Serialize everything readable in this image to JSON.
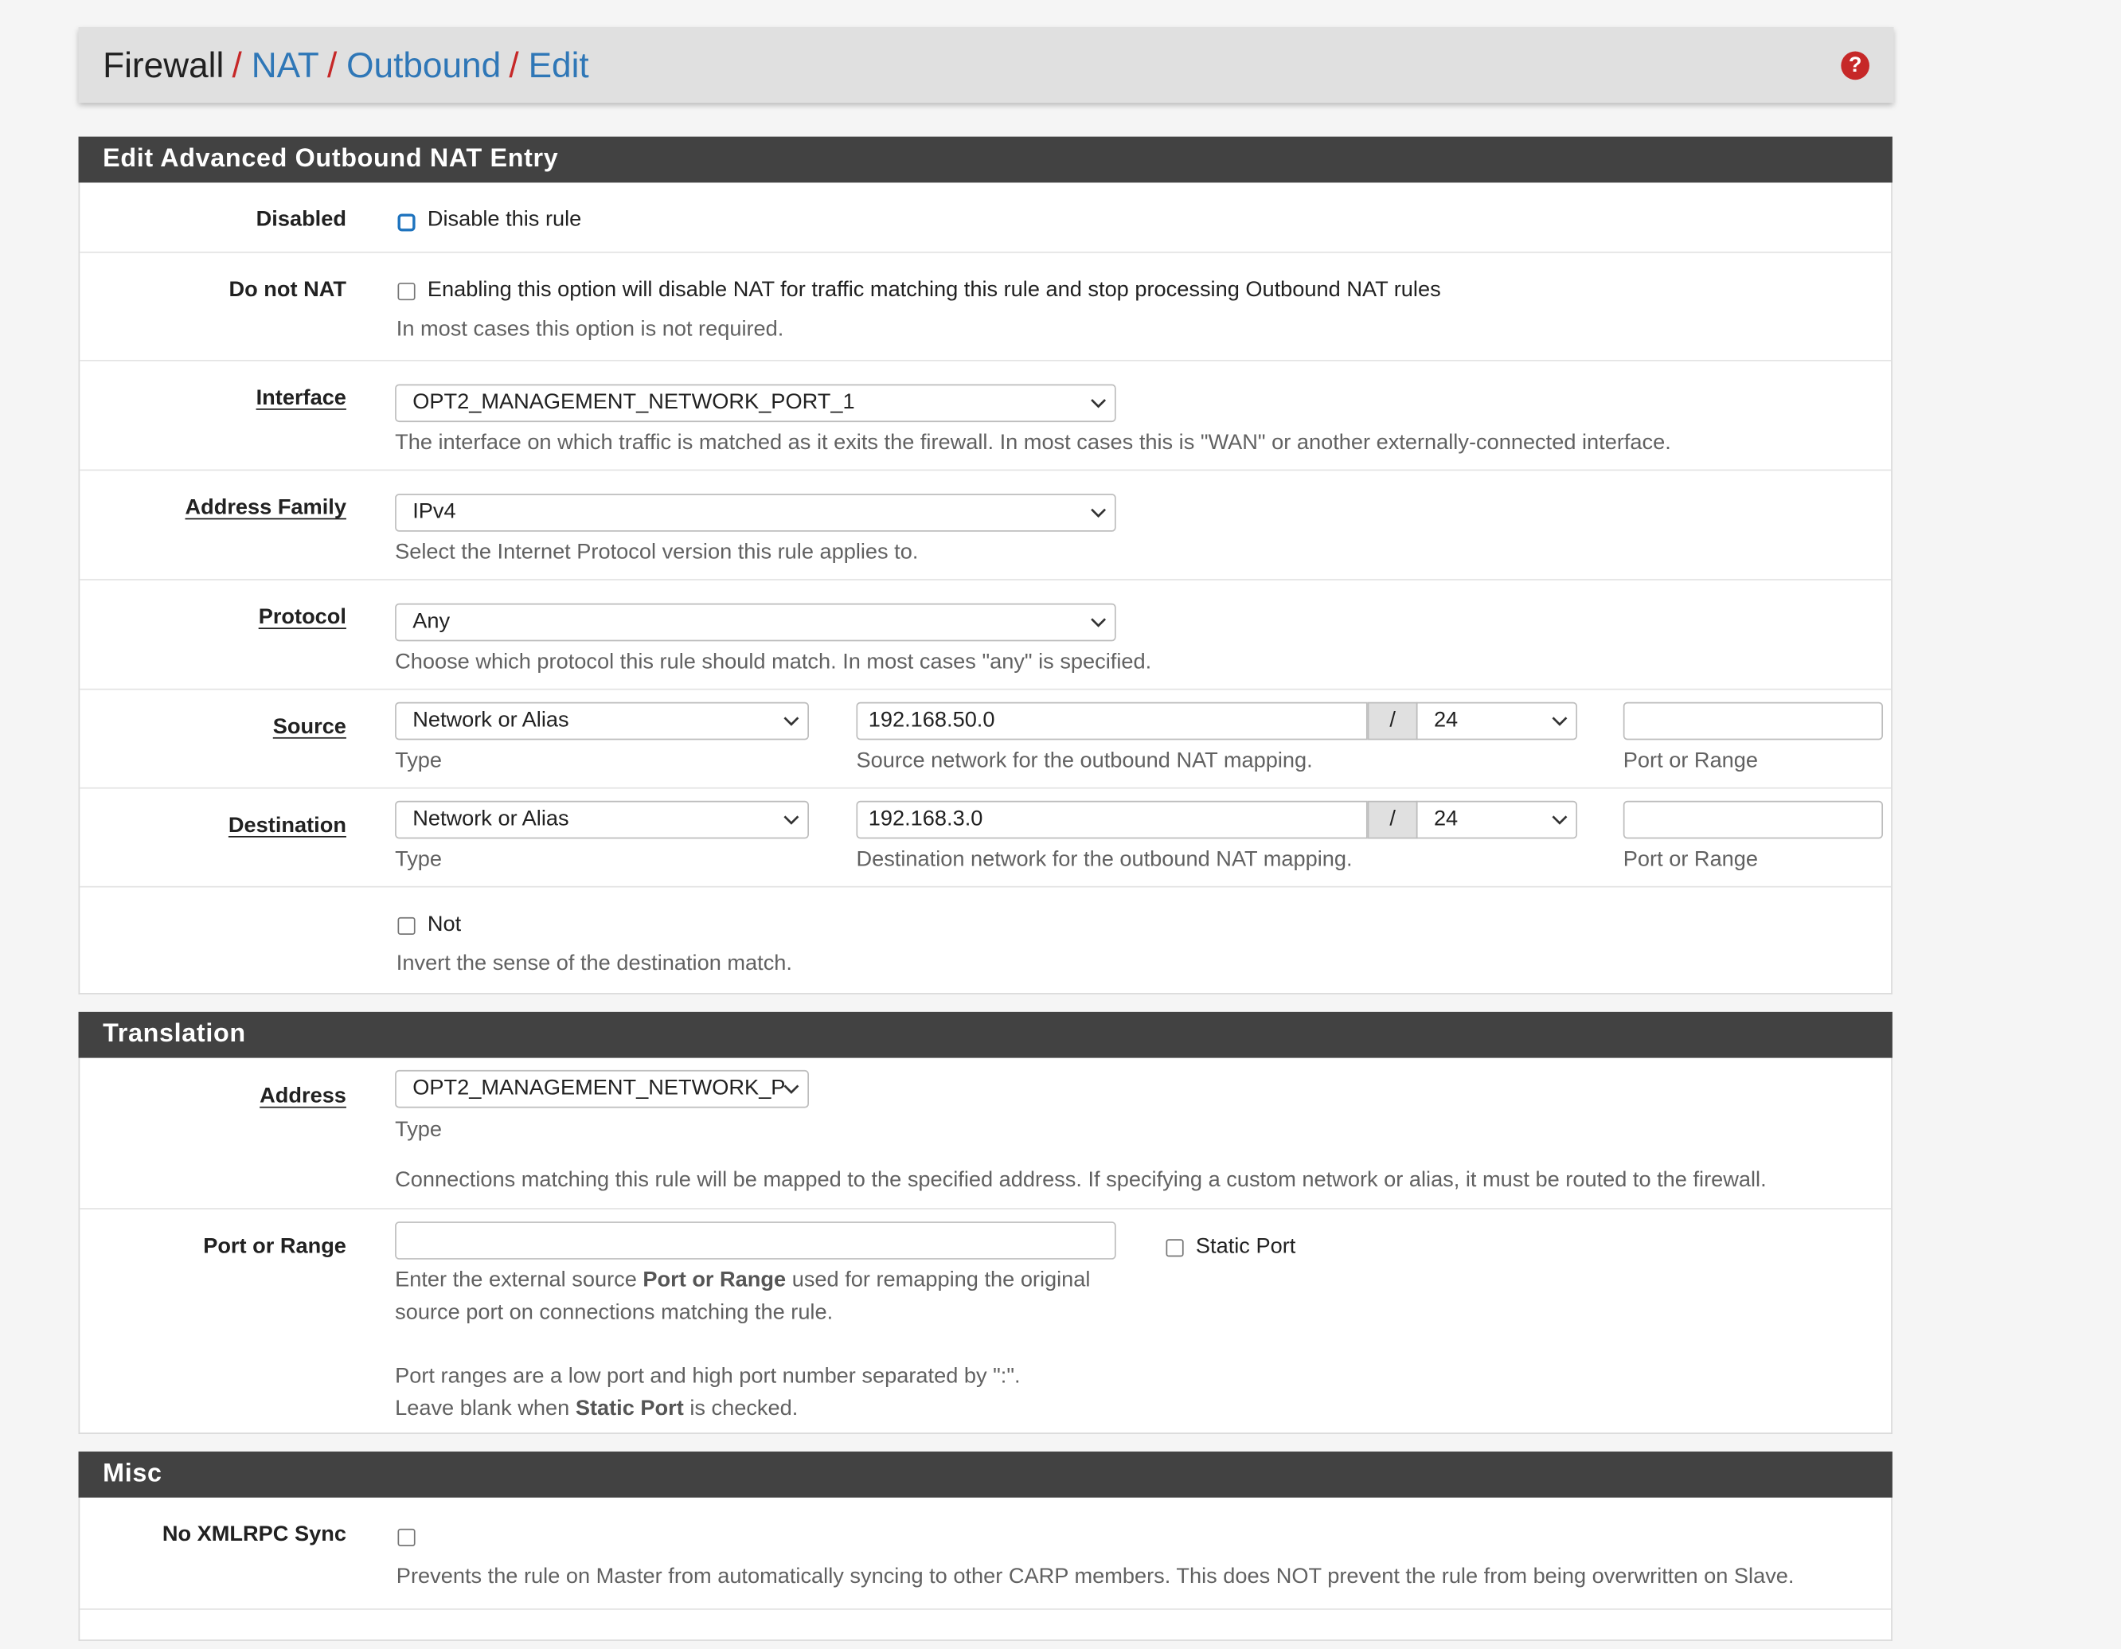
{
  "breadcrumb": {
    "root": "Firewall",
    "items": [
      "NAT",
      "Outbound",
      "Edit"
    ],
    "separator": "/"
  },
  "panels": {
    "edit": {
      "title": "Edit Advanced Outbound NAT Entry",
      "disabled": {
        "label": "Disabled",
        "checkbox_label": "Disable this rule"
      },
      "do_not_nat": {
        "label": "Do not NAT",
        "checkbox_label": "Enabling this option will disable NAT for traffic matching this rule and stop processing Outbound NAT rules",
        "help": "In most cases this option is not required."
      },
      "interface": {
        "label": "Interface",
        "value": "OPT2_MANAGEMENT_NETWORK_PORT_1",
        "help": "The interface on which traffic is matched as it exits the firewall. In most cases this is \"WAN\" or another externally-connected interface."
      },
      "address_family": {
        "label": "Address Family",
        "value": "IPv4",
        "help": "Select the Internet Protocol version this rule applies to."
      },
      "protocol": {
        "label": "Protocol",
        "value": "Any",
        "help": "Choose which protocol this rule should match. In most cases \"any\" is specified."
      },
      "source": {
        "label": "Source",
        "type_value": "Network or Alias",
        "type_help": "Type",
        "network": "192.168.50.0",
        "slash": "/",
        "mask": "24",
        "network_help": "Source network for the outbound NAT mapping.",
        "port": "",
        "port_help": "Port or Range"
      },
      "destination": {
        "label": "Destination",
        "type_value": "Network or Alias",
        "type_help": "Type",
        "network": "192.168.3.0",
        "slash": "/",
        "mask": "24",
        "network_help": "Destination network for the outbound NAT mapping.",
        "port": "",
        "port_help": "Port or Range"
      },
      "not": {
        "checkbox_label": "Not",
        "help": "Invert the sense of the destination match."
      }
    },
    "translation": {
      "title": "Translation",
      "address": {
        "label": "Address",
        "value": "OPT2_MANAGEMENT_NETWORK_P",
        "type_help": "Type",
        "help": "Connections matching this rule will be mapped to the specified address. If specifying a custom network or alias, it must be routed to the firewall."
      },
      "port_or_range": {
        "label": "Port or Range",
        "value": "",
        "static_port_label": "Static Port",
        "help_line1_pre": "Enter the external source ",
        "help_line1_bold": "Port or Range",
        "help_line1_post": " used for remapping the original",
        "help_line2": "source port on connections matching the rule.",
        "help_line3": "Port ranges are a low port and high port number separated by \":\".",
        "help_line4_pre": "Leave blank when ",
        "help_line4_bold": "Static Port",
        "help_line4_post": " is checked."
      }
    },
    "misc": {
      "title": "Misc",
      "no_xmlrpc_sync": {
        "label": "No XMLRPC Sync",
        "help": "Prevents the rule on Master from automatically syncing to other CARP members. This does NOT prevent the rule from being overwritten on Slave."
      }
    }
  },
  "colors": {
    "header_bg": "#424242",
    "link": "#2f77b7",
    "separator": "#c62828",
    "help_icon": "#c62828"
  },
  "icons": [
    "question-circle-icon",
    "chevron-down-icon"
  ]
}
